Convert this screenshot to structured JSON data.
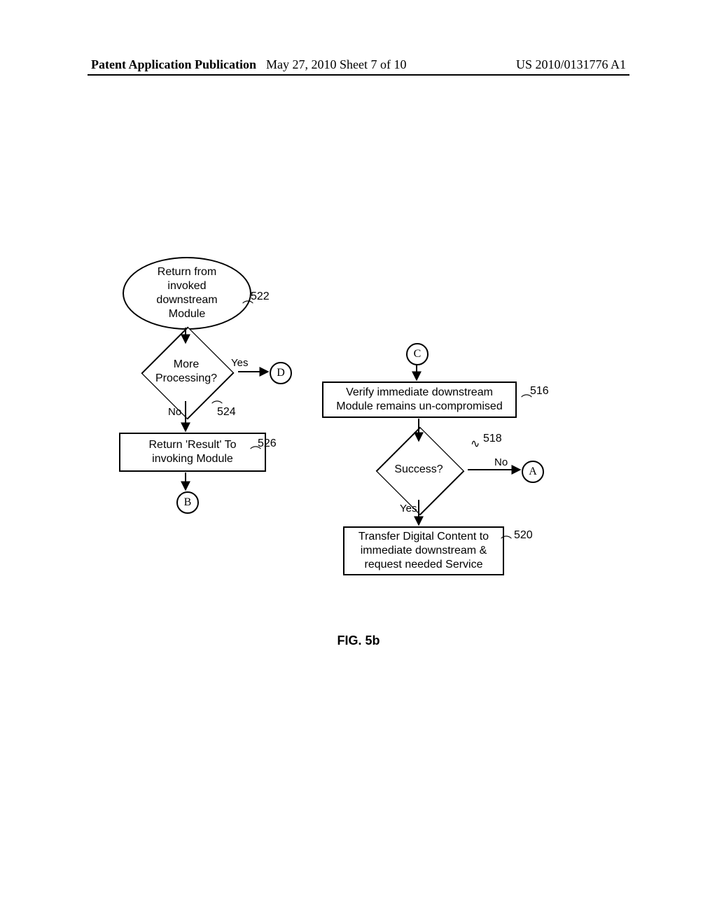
{
  "header": {
    "left": "Patent Application Publication",
    "mid_prefix": "May 27, 2010   Sheet ",
    "sheet_current": "7",
    "sheet_of": " of ",
    "sheet_total": "10",
    "right": "US 2010/0131776 A1"
  },
  "figure": {
    "label": "FIG. 5b"
  },
  "left_chart": {
    "start": {
      "text": "Return from\ninvoked\ndownstream\nModule",
      "ref": "522"
    },
    "decision": {
      "text": "More\nProcessing?",
      "ref": "524",
      "yes": "Yes",
      "no": "No"
    },
    "process": {
      "text": "Return 'Result' To\ninvoking Module",
      "ref": "526"
    },
    "conn_D": "D",
    "conn_B": "B"
  },
  "right_chart": {
    "conn_C": "C",
    "process1": {
      "text": "Verify immediate downstream\nModule remains un-compromised",
      "ref": "516"
    },
    "decision": {
      "text": "Success?",
      "ref": "518",
      "yes": "Yes",
      "no": "No"
    },
    "conn_A": "A",
    "process2": {
      "text": "Transfer Digital Content to\nimmediate downstream &\nrequest needed Service",
      "ref": "520"
    }
  }
}
